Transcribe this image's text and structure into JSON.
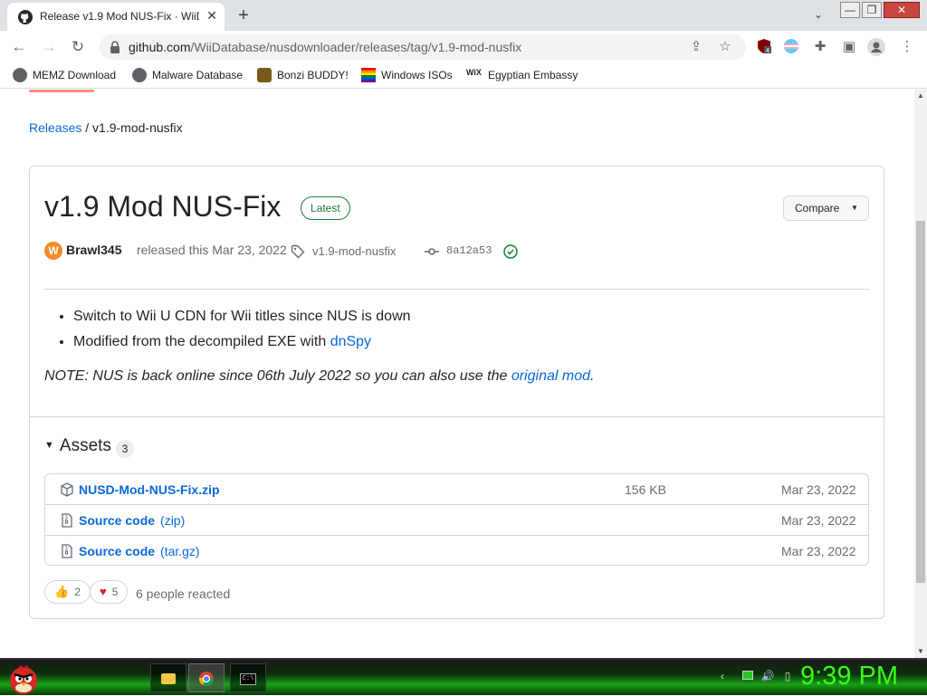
{
  "browser": {
    "tab_title": "Release v1.9 Mod NUS-Fix · WiiDatabase",
    "url_domain": "github.com",
    "url_path": "/WiiDatabase/nusdownloader/releases/tag/v1.9-mod-nusfix",
    "extension_badge": "4",
    "bookmarks": [
      "MEMZ Download",
      "Malware Database",
      "Bonzi BUDDY!",
      "Windows ISOs",
      "Egyptian Embassy"
    ]
  },
  "breadcrumb": {
    "parent": "Releases",
    "sep": "/",
    "current": "v1.9-mod-nusfix"
  },
  "release": {
    "title": "v1.9 Mod NUS-Fix",
    "badge": "Latest",
    "compare_label": "Compare",
    "author": "Brawl345",
    "released_text": "released this Mar 23, 2022",
    "tag": "v1.9-mod-nusfix",
    "commit": "8a12a53",
    "notes": [
      {
        "text": "Switch to Wii U CDN for Wii titles since NUS is down",
        "link": ""
      },
      {
        "text": "Modified from the decompiled EXE with ",
        "link": "dnSpy"
      }
    ],
    "note_prefix": "NOTE: NUS is back online since 06th July 2022 so you can also use the ",
    "note_link": "original mod",
    "note_suffix": "."
  },
  "assets": {
    "heading": "Assets",
    "count": "3",
    "rows": [
      {
        "name": "NUSD-Mod-NUS-Fix.zip",
        "ext": "",
        "size": "156 KB",
        "date": "Mar 23, 2022"
      },
      {
        "name": "Source code",
        "ext": "(zip)",
        "size": "",
        "date": "Mar 23, 2022"
      },
      {
        "name": "Source code",
        "ext": "(tar.gz)",
        "size": "",
        "date": "Mar 23, 2022"
      }
    ]
  },
  "reactions": {
    "thumbs_up": "2",
    "heart": "5",
    "summary": "6 people reacted"
  },
  "taskbar": {
    "clock": "9:39 PM"
  },
  "colors": {
    "link": "#0969da",
    "latest_green": "#1a7f37",
    "clock_green": "#39ff14"
  }
}
